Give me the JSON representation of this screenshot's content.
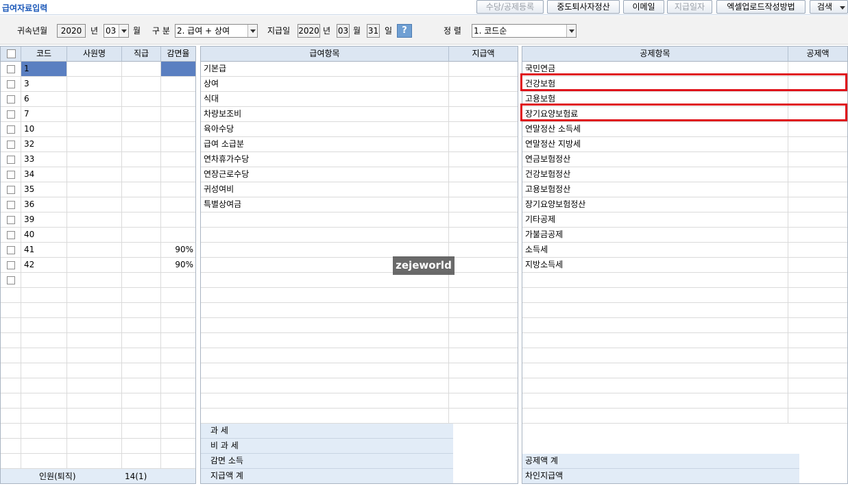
{
  "title": "급여자료입력",
  "toolbar": {
    "buttons": [
      {
        "label": "수당/공제등록",
        "disabled": true
      },
      {
        "label": "중도퇴사자정산",
        "disabled": false
      },
      {
        "label": "이메일",
        "disabled": false
      },
      {
        "label": "지급일자",
        "disabled": true
      },
      {
        "label": "엑셀업로드작성방법",
        "disabled": false
      },
      {
        "label": "검색",
        "disabled": false
      }
    ]
  },
  "filters": {
    "belong_label": "귀속년월",
    "belong_year": "2020",
    "year_unit": "년",
    "belong_month": "03",
    "month_unit": "월",
    "type_label": "구 분",
    "type_value": "2. 급여 + 상여",
    "pay_label": "지급일",
    "pay_year": "2020",
    "pay_year_unit": "년",
    "pay_month": "03",
    "pay_month_unit": "월",
    "pay_day": "31",
    "pay_day_unit": "일",
    "help": "?",
    "sort_label": "정 렬",
    "sort_value": "1. 코드순"
  },
  "employees": {
    "headers": [
      "코드",
      "사원명",
      "직급",
      "감면율"
    ],
    "rows": [
      {
        "code": "1",
        "name": "",
        "rank": "",
        "rate": ""
      },
      {
        "code": "3",
        "name": "",
        "rank": "",
        "rate": ""
      },
      {
        "code": "6",
        "name": "",
        "rank": "",
        "rate": ""
      },
      {
        "code": "7",
        "name": "",
        "rank": "",
        "rate": ""
      },
      {
        "code": "10",
        "name": "",
        "rank": "",
        "rate": ""
      },
      {
        "code": "32",
        "name": "",
        "rank": "",
        "rate": ""
      },
      {
        "code": "33",
        "name": "",
        "rank": "",
        "rate": ""
      },
      {
        "code": "34",
        "name": "",
        "rank": "",
        "rate": ""
      },
      {
        "code": "35",
        "name": "",
        "rank": "",
        "rate": ""
      },
      {
        "code": "36",
        "name": "",
        "rank": "",
        "rate": ""
      },
      {
        "code": "39",
        "name": "",
        "rank": "",
        "rate": ""
      },
      {
        "code": "40",
        "name": "",
        "rank": "",
        "rate": ""
      },
      {
        "code": "41",
        "name": "",
        "rank": "",
        "rate": "90%"
      },
      {
        "code": "42",
        "name": "",
        "rank": "",
        "rate": "90%"
      }
    ],
    "footer_label": "인원(퇴직)",
    "footer_count": "14(1)"
  },
  "pay_items": {
    "headers": [
      "급여항목",
      "지급액"
    ],
    "items": [
      "기본급",
      "상여",
      "식대",
      "차량보조비",
      "육아수당",
      "급여 소급분",
      "연차휴가수당",
      "연장근로수당",
      "귀성여비",
      "특별상여금"
    ],
    "totals": [
      "과      세",
      "비  과  세",
      "감면  소득",
      "지급액  계"
    ]
  },
  "deductions": {
    "headers": [
      "공제항목",
      "공제액"
    ],
    "items": [
      "국민연금",
      "건강보험",
      "고용보험",
      "장기요양보험료",
      "연말정산 소득세",
      "연말정산 지방세",
      "연금보험정산",
      "건강보험정산",
      "고용보험정산",
      "장기요양보험정산",
      "기타공제",
      "가불금공제",
      "소득세",
      "지방소득세"
    ],
    "highlighted": [
      "건강보험",
      "장기요양보험료"
    ],
    "totals": [
      "공제액  계",
      "차인지급액"
    ]
  },
  "watermark": "zejeworld",
  "colors": {
    "accent": "#1a57b8",
    "highlight": "#e0121a",
    "selected_row": "#5a7fc1",
    "header_bg": "#dce6f2"
  }
}
